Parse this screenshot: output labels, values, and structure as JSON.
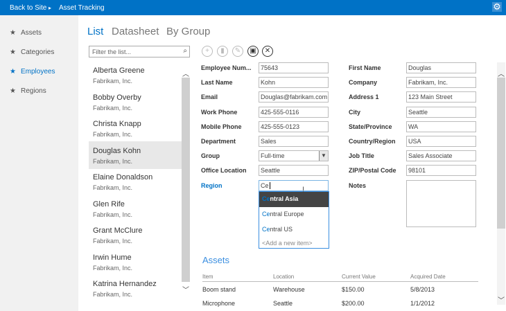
{
  "topbar": {
    "back": "Back to Site",
    "sep": "▸",
    "title": "Asset Tracking",
    "settings_icon": "gear-icon"
  },
  "sidebar": {
    "items": [
      {
        "label": "Assets"
      },
      {
        "label": "Categories"
      },
      {
        "label": "Employees",
        "active": true
      },
      {
        "label": "Regions"
      }
    ]
  },
  "tabs": [
    {
      "label": "List"
    },
    {
      "label": "Datasheet"
    },
    {
      "label": "By Group"
    }
  ],
  "filter": {
    "placeholder": "Filter the list..."
  },
  "list": [
    {
      "name": "Alberta Greene",
      "company": "Fabrikam, Inc."
    },
    {
      "name": "Bobby Overby",
      "company": "Fabrikam, Inc."
    },
    {
      "name": "Christa Knapp",
      "company": "Fabrikam, Inc."
    },
    {
      "name": "Douglas Kohn",
      "company": "Fabrikam, Inc."
    },
    {
      "name": "Elaine Donaldson",
      "company": "Fabrikam, Inc."
    },
    {
      "name": "Glen Rife",
      "company": "Fabrikam, Inc."
    },
    {
      "name": "Grant McClure",
      "company": "Fabrikam, Inc."
    },
    {
      "name": "Irwin Hume",
      "company": "Fabrikam, Inc."
    },
    {
      "name": "Katrina Hernandez",
      "company": "Fabrikam, Inc."
    }
  ],
  "form": {
    "left": [
      {
        "label": "Employee Num...",
        "value": "75643"
      },
      {
        "label": "Last Name",
        "value": "Kohn"
      },
      {
        "label": "Email",
        "value": "Douglas@fabrikam.com"
      },
      {
        "label": "Work Phone",
        "value": "425-555-0116"
      },
      {
        "label": "Mobile Phone",
        "value": "425-555-0123"
      },
      {
        "label": "Department",
        "value": "Sales"
      },
      {
        "label": "Group",
        "value": "Full-time"
      },
      {
        "label": "Office Location",
        "value": "Seattle"
      },
      {
        "label": "Region",
        "value": "Ce"
      }
    ],
    "right": [
      {
        "label": "First Name",
        "value": "Douglas"
      },
      {
        "label": "Company",
        "value": "Fabrikam, Inc."
      },
      {
        "label": "Address 1",
        "value": "123 Main Street"
      },
      {
        "label": "City",
        "value": "Seattle"
      },
      {
        "label": "State/Province",
        "value": "WA"
      },
      {
        "label": "Country/Region",
        "value": "USA"
      },
      {
        "label": "Job Title",
        "value": "Sales Associate"
      },
      {
        "label": "ZIP/Postal Code",
        "value": "98101"
      },
      {
        "label": "Notes",
        "value": ""
      }
    ]
  },
  "region_dropdown": {
    "match": "Ce",
    "options": [
      {
        "m": "Ce",
        "rest": "ntral Asia"
      },
      {
        "m": "Ce",
        "rest": "ntral Europe"
      },
      {
        "m": "Ce",
        "rest": "ntral US"
      }
    ],
    "add": "<Add a new item>"
  },
  "assets": {
    "title": "Assets",
    "columns": [
      "Item",
      "Location",
      "Current Value",
      "Acquired Date"
    ],
    "rows": [
      [
        "Boom stand",
        "Warehouse",
        "$150.00",
        "5/8/2013"
      ],
      [
        "Microphone",
        "Seattle",
        "$200.00",
        "1/1/2012"
      ]
    ]
  },
  "colors": {
    "accent": "#0072c6"
  }
}
